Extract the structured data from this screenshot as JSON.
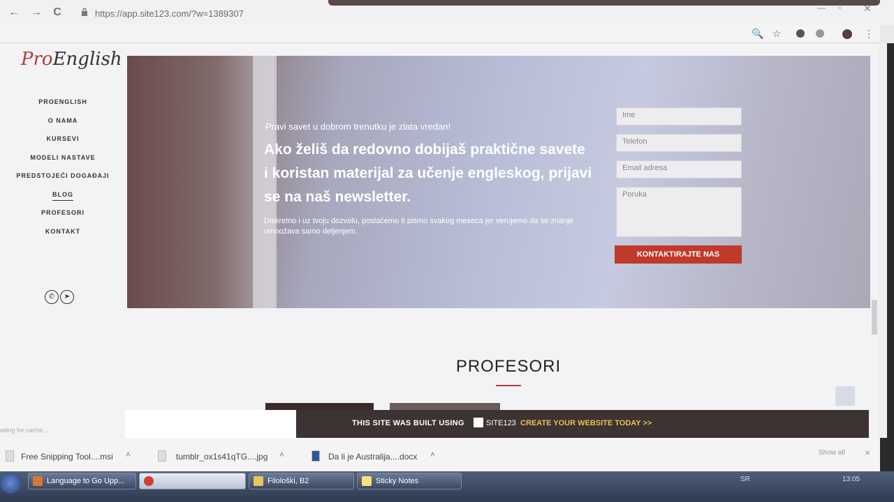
{
  "browser": {
    "url": "https://app.site123.com/?w=1389307",
    "nav_back": "←",
    "nav_forward": "→",
    "nav_reload": "C",
    "zoom_icon": "🔍",
    "star_icon": "☆"
  },
  "site": {
    "logo_pro": "Pro",
    "logo_rest": "English",
    "menu": [
      "PROENGLISH",
      "O NAMA",
      "KURSEVI",
      "MODELI NASTAVE",
      "PREDSTOJEĆI DOGAĐAJI",
      "BLOG",
      "PROFESORI",
      "KONTAKT"
    ],
    "hero": {
      "subtitle": "Pravi savet u dobrom trenutku je zlata vredan!",
      "title": "Ako želiš da redovno dobijaš praktične savete i koristan materijal za učenje engleskog, prijavi se na naš newsletter.",
      "description": "Diskretno i uz tvoju dozvolu, poslaćemo ti pismo svakog meseca jer verujemo da se znanje umnožava samo deljenjem."
    },
    "form": {
      "name_placeholder": "Ime",
      "phone_placeholder": "Telefon",
      "email_placeholder": "Email adresa",
      "message_placeholder": "Poruka",
      "submit_label": "KONTAKTIRAJTE NAS"
    },
    "section_title": "PROFESORI",
    "banner": {
      "text": "THIS SITE WAS BUILT USING",
      "brand": "SITE123",
      "cta": "CREATE YOUR WEBSITE TODAY >>"
    },
    "status_hint": "aiting for cache..."
  },
  "downloads": {
    "items": [
      "Free Snipping Tool....msi",
      "tumblr_ox1s41qTG....jpg",
      "Da li je Australija....docx"
    ],
    "show_all": "Show all",
    "close": "×"
  },
  "taskbar": {
    "tasks": [
      "Language to Go Upp...",
      "",
      "Filološki, B2",
      "Sticky Notes"
    ],
    "lang": "SR",
    "clock": "13:05"
  }
}
